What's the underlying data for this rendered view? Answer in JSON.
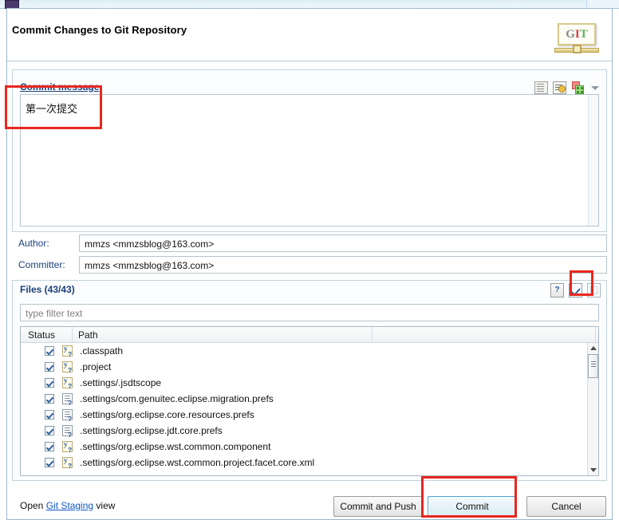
{
  "window": {
    "os_icon": "app-icon"
  },
  "dialog": {
    "title": "Commit Changes to Git Repository",
    "logo": {
      "g": "G",
      "i": "I",
      "t": "T"
    }
  },
  "commit_message": {
    "label": "Commit message",
    "value": "第一次提交",
    "tools": [
      {
        "name": "sign-commit-icon",
        "title": "Sign Commit"
      },
      {
        "name": "amend-commit-icon",
        "title": "Amend Previous Commit"
      },
      {
        "name": "add-signed-off-icon",
        "title": "Add Signed-off-by"
      },
      {
        "name": "chevron-down-icon",
        "title": "More"
      }
    ]
  },
  "fields": {
    "author_label": "Author:",
    "author_value": "mmzs <mmzsblog@163.com>",
    "committer_label": "Committer:",
    "committer_value": "mmzs <mmzsblog@163.com>"
  },
  "files": {
    "label": "Files (43/43)",
    "filter_placeholder": "type filter text",
    "tools": [
      {
        "name": "help-icon",
        "glyph": "?"
      },
      {
        "name": "select-all-checkbox-icon",
        "glyph": "checked"
      },
      {
        "name": "deselect-all-checkbox-icon",
        "glyph": "unchecked"
      }
    ],
    "columns": [
      "Status",
      "Path",
      ""
    ],
    "rows": [
      {
        "checked": true,
        "icon": "untracked-file-icon",
        "path": ".classpath"
      },
      {
        "checked": true,
        "icon": "untracked-file-icon",
        "path": ".project"
      },
      {
        "checked": true,
        "icon": "untracked-file-icon",
        "path": ".settings/.jsdtscope"
      },
      {
        "checked": true,
        "icon": "prefs-file-icon",
        "path": ".settings/com.genuitec.eclipse.migration.prefs"
      },
      {
        "checked": true,
        "icon": "prefs-file-icon",
        "path": ".settings/org.eclipse.core.resources.prefs"
      },
      {
        "checked": true,
        "icon": "prefs-file-icon",
        "path": ".settings/org.eclipse.jdt.core.prefs"
      },
      {
        "checked": true,
        "icon": "untracked-file-icon",
        "path": ".settings/org.eclipse.wst.common.component"
      },
      {
        "checked": true,
        "icon": "untracked-file-icon",
        "path": ".settings/org.eclipse.wst.common.project.facet.core.xml"
      }
    ]
  },
  "footer": {
    "open_prefix": "Open ",
    "open_link": "Git Staging",
    "open_suffix": " view",
    "commit_and_push": "Commit and Push",
    "commit": "Commit",
    "cancel": "Cancel"
  },
  "annotations": {
    "color": "#e8271f",
    "targets": [
      "commit-message-box",
      "select-all-checkbox",
      "commit-button"
    ]
  }
}
